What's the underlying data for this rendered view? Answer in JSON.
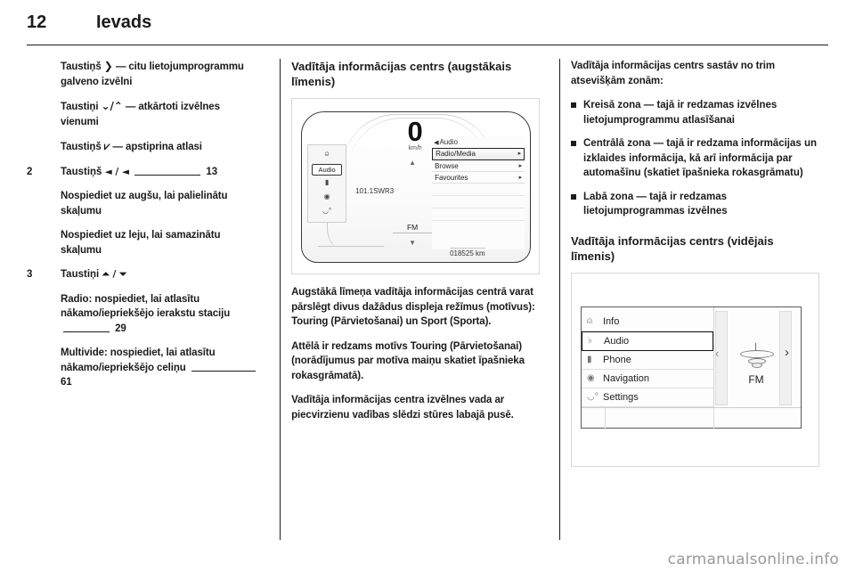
{
  "header": {
    "page_number": "12",
    "chapter_title": "Ievads"
  },
  "left_column": {
    "paragraph_1": {
      "prefix": "Taustiņš",
      "glyph": "❯",
      "text": "— citu lietojumprogrammu galveno izvēlni"
    },
    "paragraph_2": {
      "prefix": "Taustiņi",
      "glyph": "⌄/⌃",
      "text": "— atkārtoti izvēlnes vienumi"
    },
    "paragraph_3": {
      "prefix": "Taustiņš",
      "glyph": "⩗",
      "text": "— apstiprina atlasi"
    },
    "item_2": {
      "number": "2",
      "prefix": "Taustiņš",
      "glyph": "◄ / ◄",
      "page": "13"
    },
    "item_2_note_a": "Nospiediet uz augšu, lai palielinātu skaļumu",
    "item_2_note_b": "Nospiediet uz leju, lai samazinātu skaļumu",
    "item_3": {
      "number": "3",
      "prefix": "Taustiņi",
      "glyph": "⏶ / ⏷"
    },
    "item_3_note_a": {
      "text": "Radio: nospiediet, lai atlasītu nākamo/iepriekšējo ierakstu staciju",
      "page": "29"
    },
    "item_3_note_b": {
      "text": "Multivide: nospiediet, lai atlasītu nākamo/iepriekšējo celiņu",
      "page": "61"
    }
  },
  "middle_column": {
    "section_title": "Vadītāja informācijas centrs (augstākais līmenis)",
    "cluster_figure": {
      "speed_value": "0",
      "speed_unit": "km/h",
      "left_panel": {
        "audio_chip_label": "Audio",
        "icons": [
          "car-icon",
          "phone-icon",
          "navigation-icon",
          "settings-icon"
        ]
      },
      "station_text": "101.1SWR3",
      "band_label": "FM",
      "menu_breadcrumb": "Audio",
      "menu_items": [
        {
          "label": "Radio/Media",
          "selected": true
        },
        {
          "label": "Browse",
          "selected": false
        },
        {
          "label": "Favourites",
          "selected": false
        }
      ],
      "odometer": "018525 km"
    },
    "paragraph_1": "Augstākā līmeņa vadītāja informācijas centrā varat pārslēgt divus dažādus displeja režīmus (motīvus): Touring (Pārvietošanai) un Sport (Sporta).",
    "paragraph_2": "Attēlā ir redzams motīvs Touring (Pārvietošanai) (norādījumus par motīva maiņu skatiet īpašnieka rokasgrāmatā).",
    "paragraph_3": "Vadītāja informācijas centra izvēlnes vada ar piecvirzienu vadības slēdzi stūres labajā pusē."
  },
  "right_column": {
    "intro": "Vadītāja informācijas centrs sastāv no trim atsevišķām zonām:",
    "bullets": [
      "Kreisā zona — tajā ir redzamas izvēlnes lietojumprogrammu atlasīšanai",
      "Centrālā zona — tajā ir redzama informācijas un izklaides informācija, kā arī informācija par automašīnu (skatiet īpašnieka rokasgrāmatu)",
      "Labā zona — tajā ir redzamas lietojumprogrammas izvēlnes"
    ],
    "section_title": "Vadītāja informācijas centrs (vidējais līmenis)",
    "dic_figure": {
      "menu_items": [
        {
          "label": "Info",
          "icon": "car-icon",
          "selected": false
        },
        {
          "label": "Audio",
          "icon": "audio-icon",
          "selected": true
        },
        {
          "label": "Phone",
          "icon": "phone-icon",
          "selected": false
        },
        {
          "label": "Navigation",
          "icon": "compass-icon",
          "selected": false
        },
        {
          "label": "Settings",
          "icon": "gears-icon",
          "selected": false
        }
      ],
      "band_label": "FM",
      "chevron_left": "‹",
      "chevron_right": "›"
    }
  },
  "watermark": "carmanualsonline.info"
}
